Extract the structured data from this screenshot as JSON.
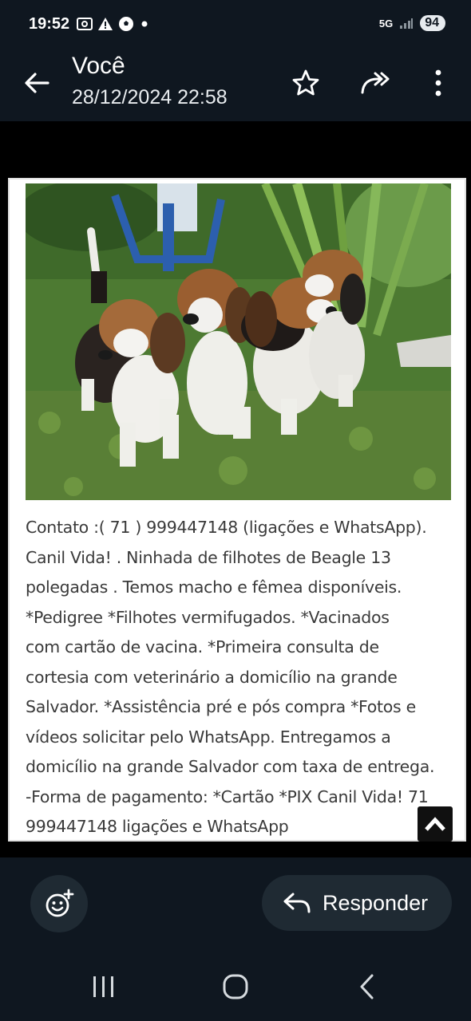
{
  "status_bar": {
    "time": "19:52",
    "network": "5G",
    "battery": "94",
    "icons": [
      "screenshot-icon",
      "warning-icon",
      "soccer-ball-icon",
      "dot-icon"
    ]
  },
  "header": {
    "sender": "Você",
    "timestamp": "28/12/2024 22:58",
    "back_icon": "back-arrow-icon",
    "actions": [
      "star-icon",
      "forward-icon",
      "more-vert-icon"
    ]
  },
  "message": {
    "image_description_icon": "photo",
    "caption_lines": [
      "Contato :( 71 ) 999447148 (ligações e WhatsApp).",
      "Canil Vida! . Ninhada de filhotes de Beagle 13",
      "polegadas . Temos macho e fêmea disponíveis.",
      "*Pedigree *Filhotes vermifugados. *Vacinados",
      "com cartão de vacina. *Primeira consulta de",
      "cortesia com veterinário a domicílio na grande",
      "Salvador. *Assistência pré e pós compra *Fotos e",
      "vídeos solicitar pelo WhatsApp. Entregamos a",
      "domicílio na grande Salvador com taxa de entrega.",
      "-Forma de pagamento: *Cartão *PIX Canil Vida! 71",
      "999447148 ligações e WhatsApp"
    ]
  },
  "bottom": {
    "reply_label": "Responder",
    "emoji_icon": "add-reaction-icon"
  },
  "nav": [
    "recents-icon",
    "home-icon",
    "back-icon"
  ],
  "colors": {
    "bar_bg": "#0f1720",
    "button_bg": "#1f2a33",
    "card_bg": "#ffffff",
    "caption_text": "#3a3a3a"
  }
}
